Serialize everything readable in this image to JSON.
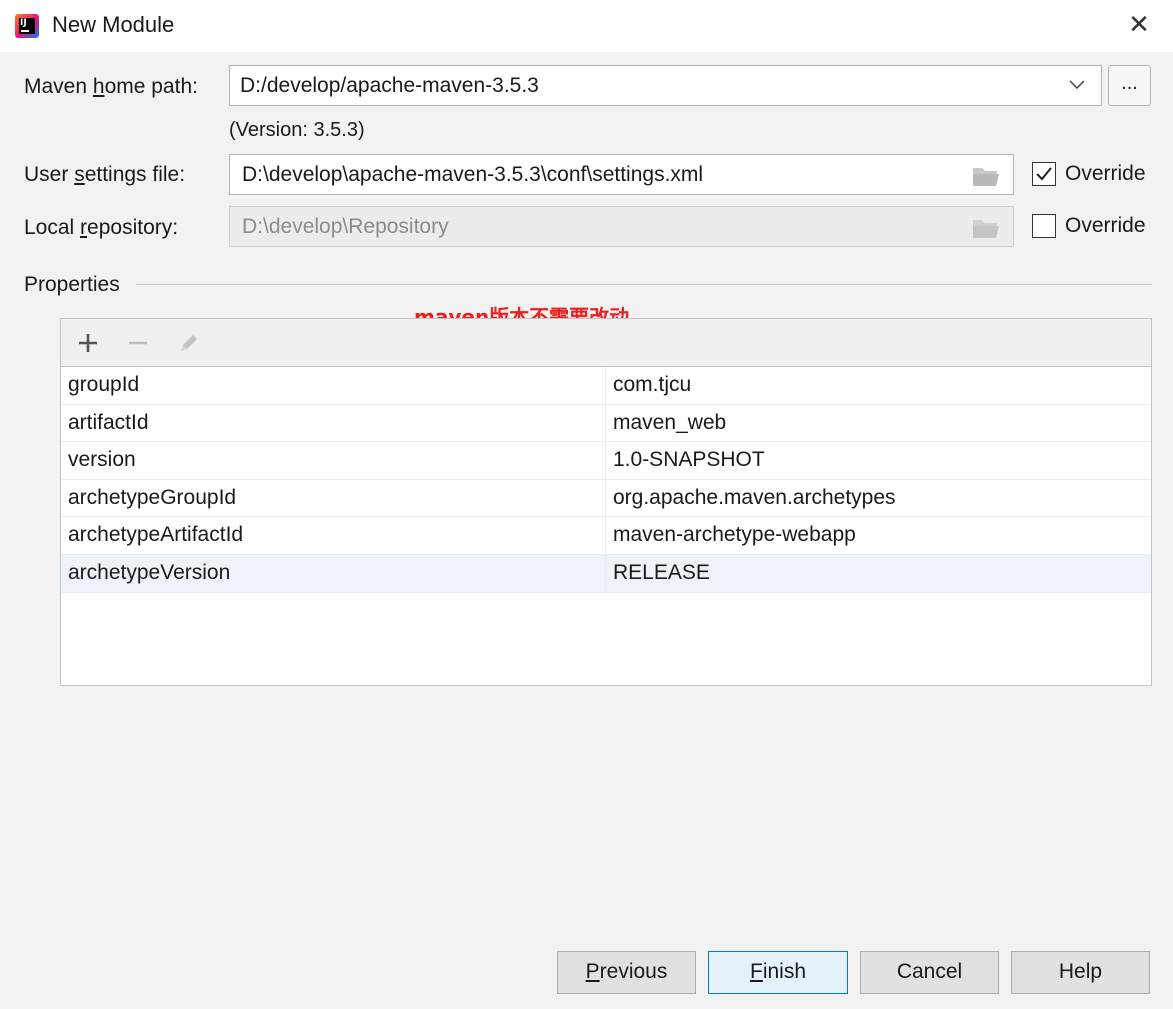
{
  "window": {
    "title": "New Module",
    "close_glyph": "✕"
  },
  "maven_home": {
    "label_pre": "Maven ",
    "label_mnemonic": "h",
    "label_post": "ome path:",
    "value": "D:/develop/apache-maven-3.5.3",
    "browse_label": "...",
    "version_note": "(Version: 3.5.3)"
  },
  "user_settings": {
    "label_pre": "User ",
    "label_mnemonic": "s",
    "label_post": "ettings file:",
    "value": "D:\\develop\\apache-maven-3.5.3\\conf\\settings.xml",
    "override_label": "Override",
    "override_checked": true
  },
  "local_repo": {
    "label_pre": "Local ",
    "label_mnemonic": "r",
    "label_post": "epository:",
    "value": "D:\\develop\\Repository",
    "override_label": "Override",
    "override_checked": false
  },
  "properties": {
    "section_title": "Properties",
    "annotation": "maven版本不需要改动",
    "annotation_color": "#e8201e",
    "toolbar": {
      "add_icon": "plus-icon",
      "remove_icon": "minus-icon",
      "edit_icon": "pencil-icon"
    },
    "rows": [
      {
        "key": "groupId",
        "value": "com.tjcu"
      },
      {
        "key": "artifactId",
        "value": "maven_web"
      },
      {
        "key": "version",
        "value": "1.0-SNAPSHOT"
      },
      {
        "key": "archetypeGroupId",
        "value": "org.apache.maven.archetypes"
      },
      {
        "key": "archetypeArtifactId",
        "value": "maven-archetype-webapp"
      },
      {
        "key": "archetypeVersion",
        "value": "RELEASE"
      }
    ],
    "selected_row": 5
  },
  "buttons": {
    "previous": {
      "mnemonic": "P",
      "rest": "revious"
    },
    "finish": {
      "mnemonic": "F",
      "rest": "inish"
    },
    "cancel": "Cancel",
    "help": "Help"
  },
  "colors": {
    "dialog_bg": "#f2f2f2",
    "default_button_border": "#0078d7"
  }
}
